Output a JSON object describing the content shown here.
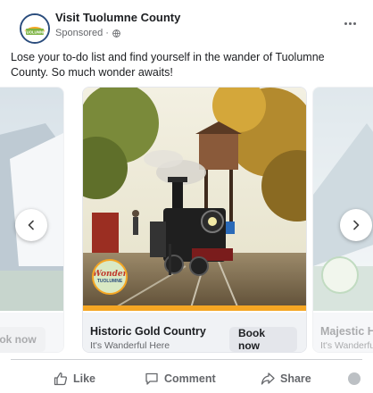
{
  "post": {
    "page_name": "Visit Tuolumne County",
    "sponsored_label": "Sponsored · ",
    "avatar_logo_text": "TUOLUMNE",
    "caption": "Lose your to-do list and find yourself in the wander of Tuolumne County. So much wonder awaits!"
  },
  "carousel": {
    "cards": [
      {
        "title": "",
        "subtitle": "",
        "cta": "Book now"
      },
      {
        "title": "Historic Gold Country",
        "subtitle": "It's Wanderful Here",
        "cta": "Book now",
        "badge_text": "Wonder",
        "badge_subtext": "TUOLUMNE"
      },
      {
        "title": "Majestic H",
        "subtitle": "It's Wanderfu",
        "cta": ""
      }
    ]
  },
  "actions": {
    "like": "Like",
    "comment": "Comment",
    "share": "Share"
  },
  "colors": {
    "accent_orange": "#f5a623",
    "brand_navy": "#2b4d7d"
  },
  "icons": [
    "globe-icon",
    "more-options-icon",
    "chevron-left-icon",
    "chevron-right-icon",
    "like-icon",
    "comment-icon",
    "share-icon"
  ]
}
